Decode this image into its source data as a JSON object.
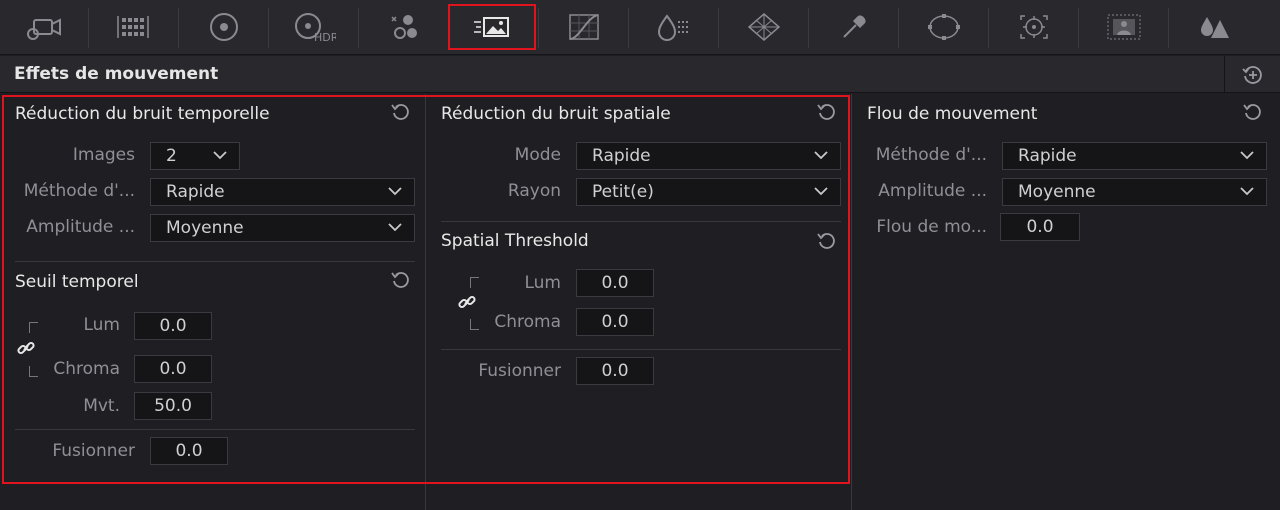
{
  "toolbar": {
    "items": [
      {
        "icon": "camera-raw-icon"
      },
      {
        "icon": "color-match-icon"
      },
      {
        "icon": "color-wheels-icon"
      },
      {
        "icon": "hdr-wheels-icon",
        "label": "HDR"
      },
      {
        "icon": "rgb-mixer-icon"
      },
      {
        "icon": "motion-effects-icon",
        "active": true
      },
      {
        "icon": "curves-icon"
      },
      {
        "icon": "color-warper-icon"
      },
      {
        "icon": "qualifier-icon"
      },
      {
        "icon": "windows-icon"
      },
      {
        "icon": "tracker-icon"
      },
      {
        "icon": "magic-mask-icon"
      },
      {
        "icon": "blur-icon"
      },
      {
        "icon": "key-icon"
      }
    ]
  },
  "header": {
    "title": "Effets de mouvement"
  },
  "temporal": {
    "title": "Réduction du bruit temporelle",
    "images_label": "Images",
    "images_value": "2",
    "method_label": "Méthode d'...",
    "method_value": "Rapide",
    "amplitude_label": "Amplitude ...",
    "amplitude_value": "Moyenne",
    "threshold": {
      "title": "Seuil temporel",
      "lum_label": "Lum",
      "lum_value": "0.0",
      "chroma_label": "Chroma",
      "chroma_value": "0.0",
      "mvt_label": "Mvt.",
      "mvt_value": "50.0"
    },
    "blend_label": "Fusionner",
    "blend_value": "0.0"
  },
  "spatial": {
    "title": "Réduction du bruit spatiale",
    "mode_label": "Mode",
    "mode_value": "Rapide",
    "radius_label": "Rayon",
    "radius_value": "Petit(e)",
    "threshold": {
      "title": "Spatial Threshold",
      "lum_label": "Lum",
      "lum_value": "0.0",
      "chroma_label": "Chroma",
      "chroma_value": "0.0"
    },
    "blend_label": "Fusionner",
    "blend_value": "0.0"
  },
  "motion_blur": {
    "title": "Flou de mouvement",
    "method_label": "Méthode d'...",
    "method_value": "Rapide",
    "amplitude_label": "Amplitude ...",
    "amplitude_value": "Moyenne",
    "blur_label": "Flou de mo...",
    "blur_value": "0.0"
  },
  "colors": {
    "highlight": "#e0141e",
    "panel_bg": "#1f1f23",
    "toolbar_bg": "#28282d"
  }
}
